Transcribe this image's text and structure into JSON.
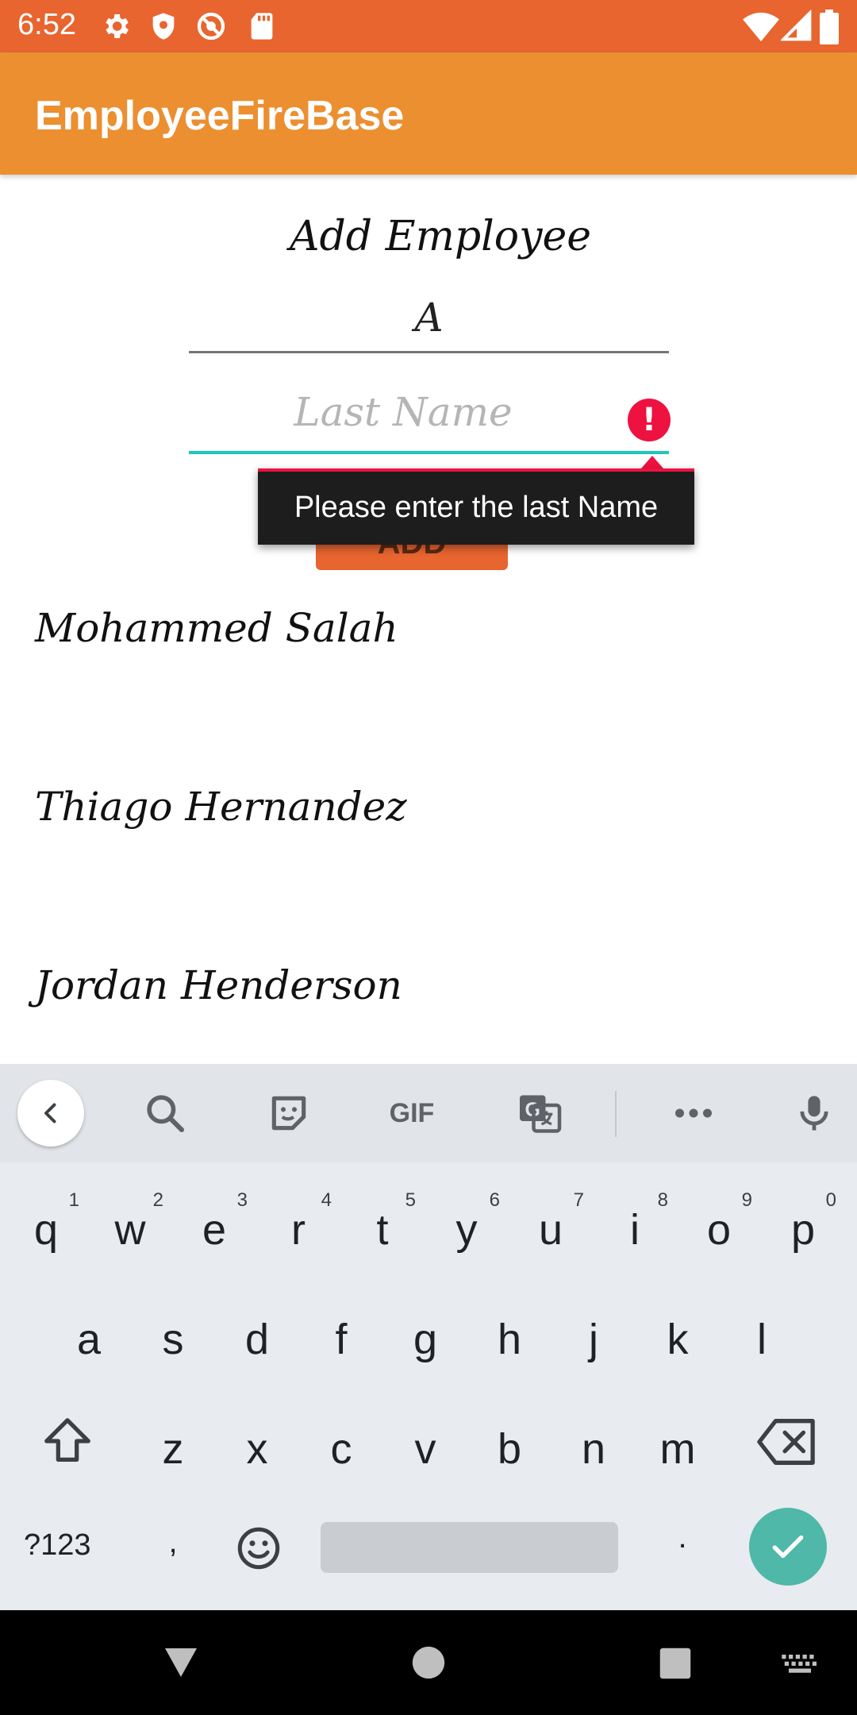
{
  "status_bar": {
    "time": "6:52",
    "left_icons": [
      "settings-icon",
      "shield-icon",
      "no-disturb-icon",
      "sd-card-icon"
    ],
    "right_icons": [
      "wifi-icon",
      "signal-icon",
      "battery-icon"
    ],
    "color": "#E86530"
  },
  "app_bar": {
    "title": "EmployeeFireBase",
    "color": "#EC8F31"
  },
  "form": {
    "title": "Add Employee",
    "first_name_value": "A",
    "last_name_placeholder": "Last Name",
    "add_button_label": "ADD",
    "error_message": "Please enter the last Name",
    "error_color": "#EE1240",
    "focus_color": "#1DC7B8"
  },
  "employees": [
    {
      "name": "Mohammed  Salah"
    },
    {
      "name": "Thiago Hernandez"
    },
    {
      "name": "Jordan Henderson"
    }
  ],
  "keyboard": {
    "toolbar_icons": [
      "back-icon",
      "search-icon",
      "sticker-icon",
      "gif-icon",
      "translate-icon",
      "more-icon",
      "mic-icon"
    ],
    "gif_label": "GIF",
    "row1": [
      {
        "c": "q",
        "h": "1"
      },
      {
        "c": "w",
        "h": "2"
      },
      {
        "c": "e",
        "h": "3"
      },
      {
        "c": "r",
        "h": "4"
      },
      {
        "c": "t",
        "h": "5"
      },
      {
        "c": "y",
        "h": "6"
      },
      {
        "c": "u",
        "h": "7"
      },
      {
        "c": "i",
        "h": "8"
      },
      {
        "c": "o",
        "h": "9"
      },
      {
        "c": "p",
        "h": "0"
      }
    ],
    "row2": [
      "a",
      "s",
      "d",
      "f",
      "g",
      "h",
      "j",
      "k",
      "l"
    ],
    "row3": [
      "z",
      "x",
      "c",
      "v",
      "b",
      "n",
      "m"
    ],
    "symbols_label": "?123",
    "comma": ",",
    "period": ".",
    "enter_color": "#4FB8A8"
  },
  "nav_bar": {
    "icons": [
      "back-triangle-icon",
      "home-circle-icon",
      "recents-square-icon",
      "keyboard-icon"
    ]
  }
}
